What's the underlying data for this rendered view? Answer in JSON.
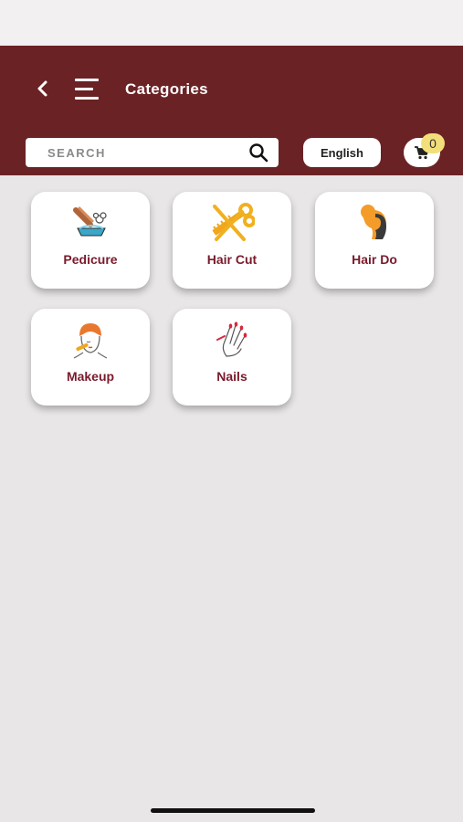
{
  "header": {
    "title": "Categories",
    "back_glyph": "<",
    "background_color": "#6b2224"
  },
  "search": {
    "placeholder": "SEARCH",
    "icon": "search-icon"
  },
  "language": {
    "selected": "English"
  },
  "cart": {
    "count": "0",
    "icon": "cart-icon",
    "badge_color": "#f3df7a"
  },
  "categories": [
    {
      "label": "Pedicure",
      "icon": "pedicure-icon"
    },
    {
      "label": "Hair Cut",
      "icon": "scissors-comb-icon"
    },
    {
      "label": "Hair Do",
      "icon": "hairstyle-icon"
    },
    {
      "label": "Makeup",
      "icon": "makeup-face-icon"
    },
    {
      "label": "Nails",
      "icon": "manicure-hand-icon"
    }
  ],
  "colors": {
    "accent": "#7a1a2c",
    "page_background": "#e9e6e7"
  }
}
